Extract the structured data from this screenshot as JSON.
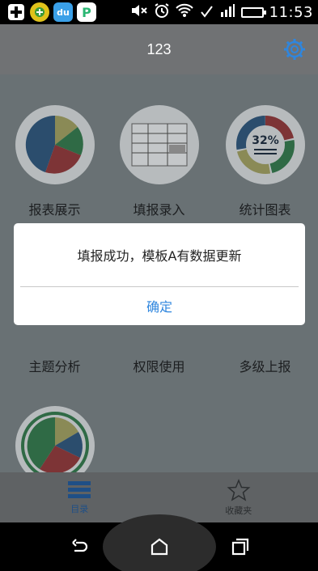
{
  "status_bar": {
    "time": "11:53",
    "network": "4G",
    "apps": [
      {
        "icon": "plus-cross-icon",
        "color": "#ffffff"
      },
      {
        "icon": "green-app-icon",
        "color": "#e0c21a"
      },
      {
        "icon": "du-app-icon",
        "color": "#3aa0e8"
      },
      {
        "icon": "p-app-icon",
        "color": "#2bb673"
      }
    ]
  },
  "header": {
    "title": "123"
  },
  "tiles": [
    {
      "label": "报表展示",
      "icon": "pie-chart-icon"
    },
    {
      "label": "填报录入",
      "icon": "form-entry-icon"
    },
    {
      "label": "统计图表",
      "icon": "donut-chart-icon",
      "badge": "32%"
    },
    {
      "label": "主题分析",
      "icon": "theme-analysis-icon"
    },
    {
      "label": "权限使用",
      "icon": "permission-icon"
    },
    {
      "label": "多级上报",
      "icon": "multi-level-report-icon"
    },
    {
      "label": "",
      "icon": "segmented-pie-icon"
    }
  ],
  "dialog": {
    "message": "填报成功，模板A有数据更新",
    "confirm_label": "确定"
  },
  "tabbar": {
    "tabs": [
      {
        "label": "目录",
        "icon": "menu-list-icon",
        "active": true
      },
      {
        "label": "收藏夹",
        "icon": "star-icon",
        "active": false
      }
    ]
  },
  "colors": {
    "accent": "#2f86de",
    "dialog_bg": "#ffffff"
  }
}
